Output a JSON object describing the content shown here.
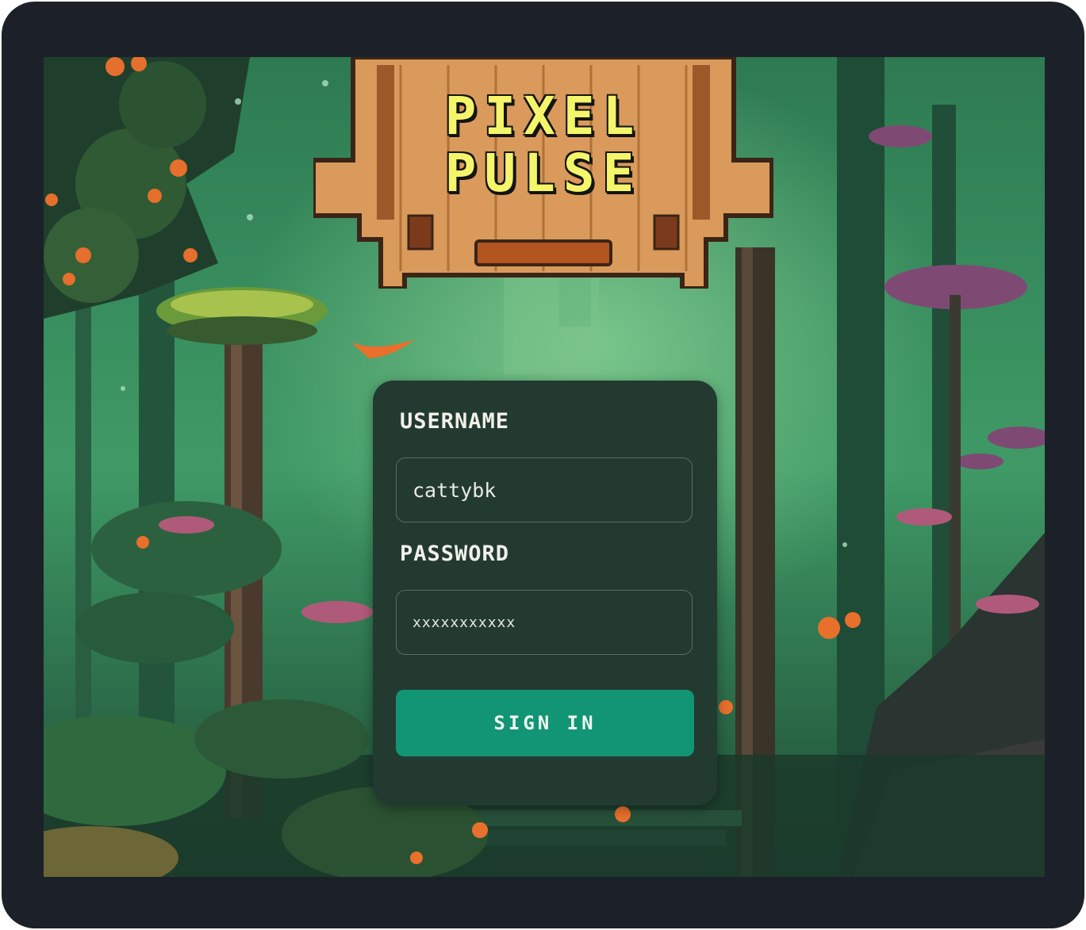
{
  "app": {
    "logo_line1": "PIXEL",
    "logo_line2": "PULSE"
  },
  "form": {
    "username_label": "USERNAME",
    "username_value": "cattybk",
    "password_label": "PASSWORD",
    "password_value": "xxxxxxxxxxx",
    "submit_label": "SIGN IN"
  },
  "colors": {
    "frame": "#1c2129",
    "panel": "#233a30",
    "button": "#129574",
    "logo_text": "#f4f56a",
    "sign_wood": "#d99a5b"
  }
}
